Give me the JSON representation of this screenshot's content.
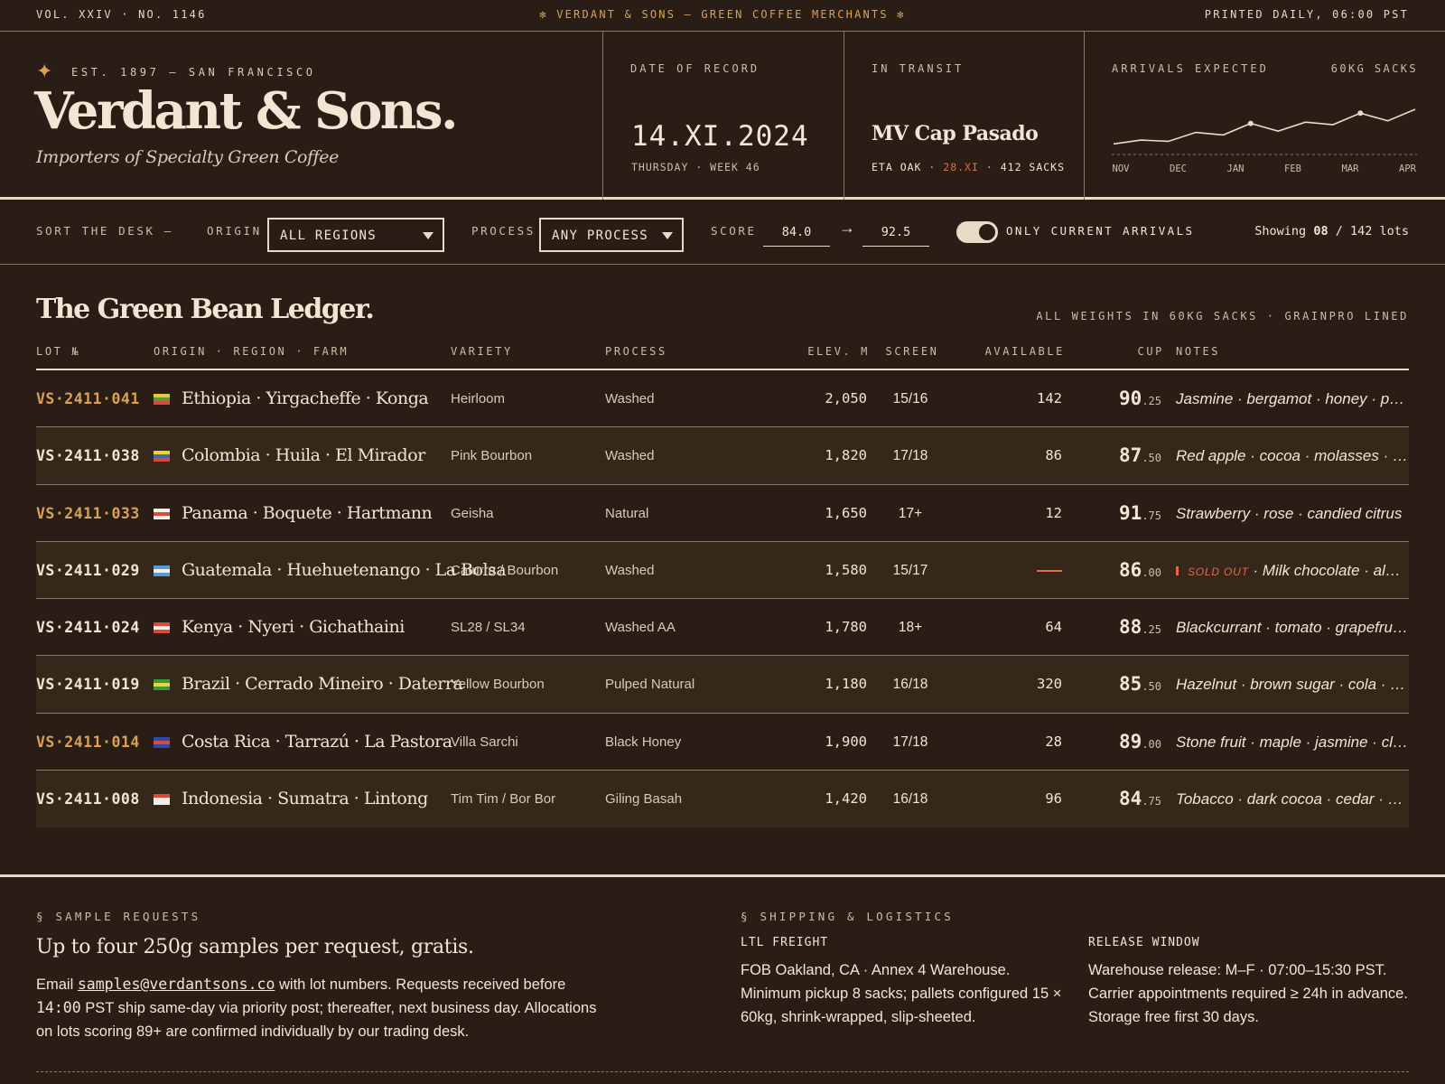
{
  "topbar": {
    "left": "VOL. XXIV  ·  NO. 1146",
    "center": "✻ VERDANT & SONS — GREEN COFFEE MERCHANTS ✻",
    "right": "PRINTED DAILY, 06:00 PST"
  },
  "brand": {
    "est": "EST. 1897 — SAN FRANCISCO",
    "name": "Verdant & Sons.",
    "tagline": "Importers of Specialty Green Coffee",
    "star_icon": "four-point-star-icon"
  },
  "date_of_record": {
    "label": "DATE OF RECORD",
    "value": "14.XI.2024",
    "day": "THURSDAY",
    "week": "WEEK 46"
  },
  "in_transit": {
    "label": "IN TRANSIT",
    "vessel": "MV Cap Pasado",
    "eta_label": "ETA OAK",
    "eta_date": "28.XI",
    "sacks": "412 SACKS"
  },
  "arrivals": {
    "label": "ARRIVALS EXPECTED",
    "unit": "60KG SACKS",
    "months": [
      "NOV",
      "DEC",
      "JAN",
      "FEB",
      "MAR",
      "APR"
    ],
    "values": [
      0.2,
      0.35,
      0.3,
      0.65,
      0.55,
      1.0,
      0.7,
      1.05,
      0.95,
      1.4,
      1.1,
      1.55
    ]
  },
  "filters": {
    "sort_label": "SORT THE DESK —",
    "origin_label": "ORIGIN",
    "origin_value": "ALL REGIONS",
    "process_label": "PROCESS",
    "process_value": "ANY PROCESS",
    "score_label": "SCORE",
    "score_min": "84.0",
    "score_arrow": "→",
    "score_max": "92.5",
    "toggle_label": "ONLY CURRENT ARRIVALS",
    "toggle_on": true,
    "showing_prefix": "Showing",
    "showing_count": "08",
    "showing_suffix": "/ 142 lots"
  },
  "ledger": {
    "title": "The Green Bean Ledger.",
    "note": "ALL WEIGHTS IN 60KG SACKS · GRAINPRO LINED",
    "columns": {
      "lot": "LOT №",
      "origin": "ORIGIN · REGION · FARM",
      "variety": "VARIETY",
      "process": "PROCESS",
      "elev": "ELEV. M",
      "screen": "SCREEN",
      "available": "AVAILABLE",
      "cup": "CUP",
      "notes": "NOTES"
    },
    "rows": [
      {
        "lot": "VS·2411·041",
        "highlight": true,
        "flag": [
          "#e8c73a",
          "#5a9a3a",
          "#d84a3a"
        ],
        "origin": "Ethiopia · Yirgacheffe · Konga",
        "variety": "Heirloom",
        "process": "Washed",
        "elev": "2,050",
        "screen": "15/16",
        "available": "142",
        "cup_main": "90",
        "cup_frac": ".25",
        "notes": "Jasmine · bergamot · honey · peach"
      },
      {
        "lot": "VS·2411·038",
        "highlight": false,
        "flag": [
          "#f2d23a",
          "#3a6ab0",
          "#d84a3a"
        ],
        "origin": "Colombia · Huila · El Mirador",
        "variety": "Pink Bourbon",
        "process": "Washed",
        "elev": "1,820",
        "screen": "17/18",
        "available": "86",
        "cup_main": "87",
        "cup_frac": ".50",
        "notes": "Red apple · cocoa · molasses · plum"
      },
      {
        "lot": "VS·2411·033",
        "highlight": true,
        "flag": [
          "#f3f0ea",
          "#d84a3a",
          "#f3f0ea"
        ],
        "origin": "Panama · Boquete · Hartmann",
        "variety": "Geisha",
        "process": "Natural",
        "elev": "1,650",
        "screen": "17+",
        "available": "12",
        "cup_main": "91",
        "cup_frac": ".75",
        "notes": "Strawberry · rose · candied citrus"
      },
      {
        "lot": "VS·2411·029",
        "highlight": false,
        "flag": [
          "#5a9ad0",
          "#f3f0ea",
          "#5a9ad0"
        ],
        "origin": "Guatemala · Huehuetenango · La Bolsa",
        "variety": "Caturra / Bourbon",
        "process": "Washed",
        "elev": "1,580",
        "screen": "15/17",
        "available": "",
        "sold_out": true,
        "sold_out_label": "SOLD OUT",
        "cup_main": "86",
        "cup_frac": ".00",
        "notes": "· Milk chocolate · almond · toffee"
      },
      {
        "lot": "VS·2411·024",
        "highlight": false,
        "flag": [
          "#d84a3a",
          "#f3f0ea",
          "#d84a3a"
        ],
        "origin": "Kenya · Nyeri · Gichathaini",
        "variety": "SL28 / SL34",
        "process": "Washed AA",
        "elev": "1,780",
        "screen": "18+",
        "available": "64",
        "cup_main": "88",
        "cup_frac": ".25",
        "notes": "Blackcurrant · tomato · grapefruit · sugar"
      },
      {
        "lot": "VS·2411·019",
        "highlight": false,
        "flag": [
          "#3a9a3a",
          "#f2d23a",
          "#3a9a3a"
        ],
        "origin": "Brazil · Cerrado Mineiro · Daterra",
        "variety": "Yellow Bourbon",
        "process": "Pulped Natural",
        "elev": "1,180",
        "screen": "16/18",
        "available": "320",
        "cup_main": "85",
        "cup_frac": ".50",
        "notes": "Hazelnut · brown sugar · cola · cedar"
      },
      {
        "lot": "VS·2411·014",
        "highlight": true,
        "flag": [
          "#2a4ab0",
          "#d84a3a",
          "#2a4ab0"
        ],
        "origin": "Costa Rica · Tarrazú · La Pastora",
        "variety": "Villa Sarchi",
        "process": "Black Honey",
        "elev": "1,900",
        "screen": "17/18",
        "available": "28",
        "cup_main": "89",
        "cup_frac": ".00",
        "notes": "Stone fruit · maple · jasmine · clove"
      },
      {
        "lot": "VS·2411·008",
        "highlight": false,
        "flag": [
          "#d84a3a",
          "#f3f0ea",
          "#f3f0ea"
        ],
        "origin": "Indonesia · Sumatra · Lintong",
        "variety": "Tim Tim / Bor Bor",
        "process": "Giling Basah",
        "elev": "1,420",
        "screen": "16/18",
        "available": "96",
        "cup_main": "84",
        "cup_frac": ".75",
        "notes": "Tobacco · dark cocoa · cedar · earth"
      }
    ]
  },
  "footer": {
    "samples": {
      "title": "§ SAMPLE REQUESTS",
      "headline": "Up to four 250g samples per request, gratis.",
      "body_prefix": "Email",
      "email": "samples@verdantsons.co",
      "body_1": "with lot numbers. Requests received before",
      "time": "14:00",
      "body_2": "PST ship same-day via priority post; thereafter, next business day. Allocations on lots scoring 89+ are confirmed individually by our trading desk."
    },
    "shipping": {
      "title": "§ SHIPPING & LOGISTICS",
      "ltl_title": "LTL FREIGHT",
      "ltl_body": "FOB Oakland, CA · Annex 4 Warehouse. Minimum pickup 8 sacks; pallets configured 15 × 60kg, shrink-wrapped, slip-sheeted.",
      "release_title": "RELEASE WINDOW",
      "release_body": "Warehouse release: M–F · 07:00–15:30 PST. Carrier appointments required ≥ 24h in advance. Storage free first 30 days."
    }
  },
  "colors": {
    "background": "#2a1d15",
    "row_alt": "#352719",
    "ink": "#f1e6d4",
    "accent_gold": "#d9a05a",
    "alert_red": "#e36a4b"
  }
}
